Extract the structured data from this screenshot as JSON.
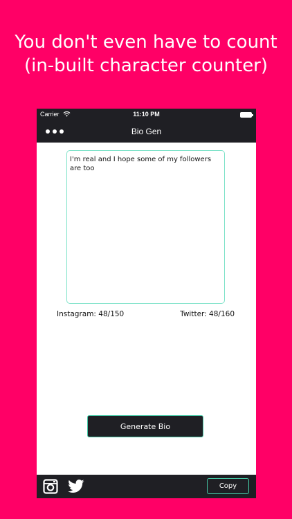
{
  "headline": {
    "line1": "You don't even have to count",
    "line2": "(in-built character counter)"
  },
  "status_bar": {
    "carrier": "Carrier",
    "time": "11:10 PM",
    "icons": [
      "wifi-icon",
      "battery-icon"
    ]
  },
  "nav_bar": {
    "title": "Bio Gen",
    "menu_icon": "ellipsis-icon"
  },
  "bio": {
    "text": "I'm real and I hope some of my followers are too"
  },
  "counters": {
    "instagram": "Instagram: 48/150",
    "twitter": "Twitter: 48/160"
  },
  "actions": {
    "generate_label": "Generate Bio",
    "copy_label": "Copy"
  },
  "bottom_bar": {
    "icons": [
      "instagram-icon",
      "twitter-icon"
    ]
  },
  "colors": {
    "background": "#FF0066",
    "bar": "#1f1f24",
    "accent": "#45c9a6",
    "input_border": "#7fe3c9"
  }
}
